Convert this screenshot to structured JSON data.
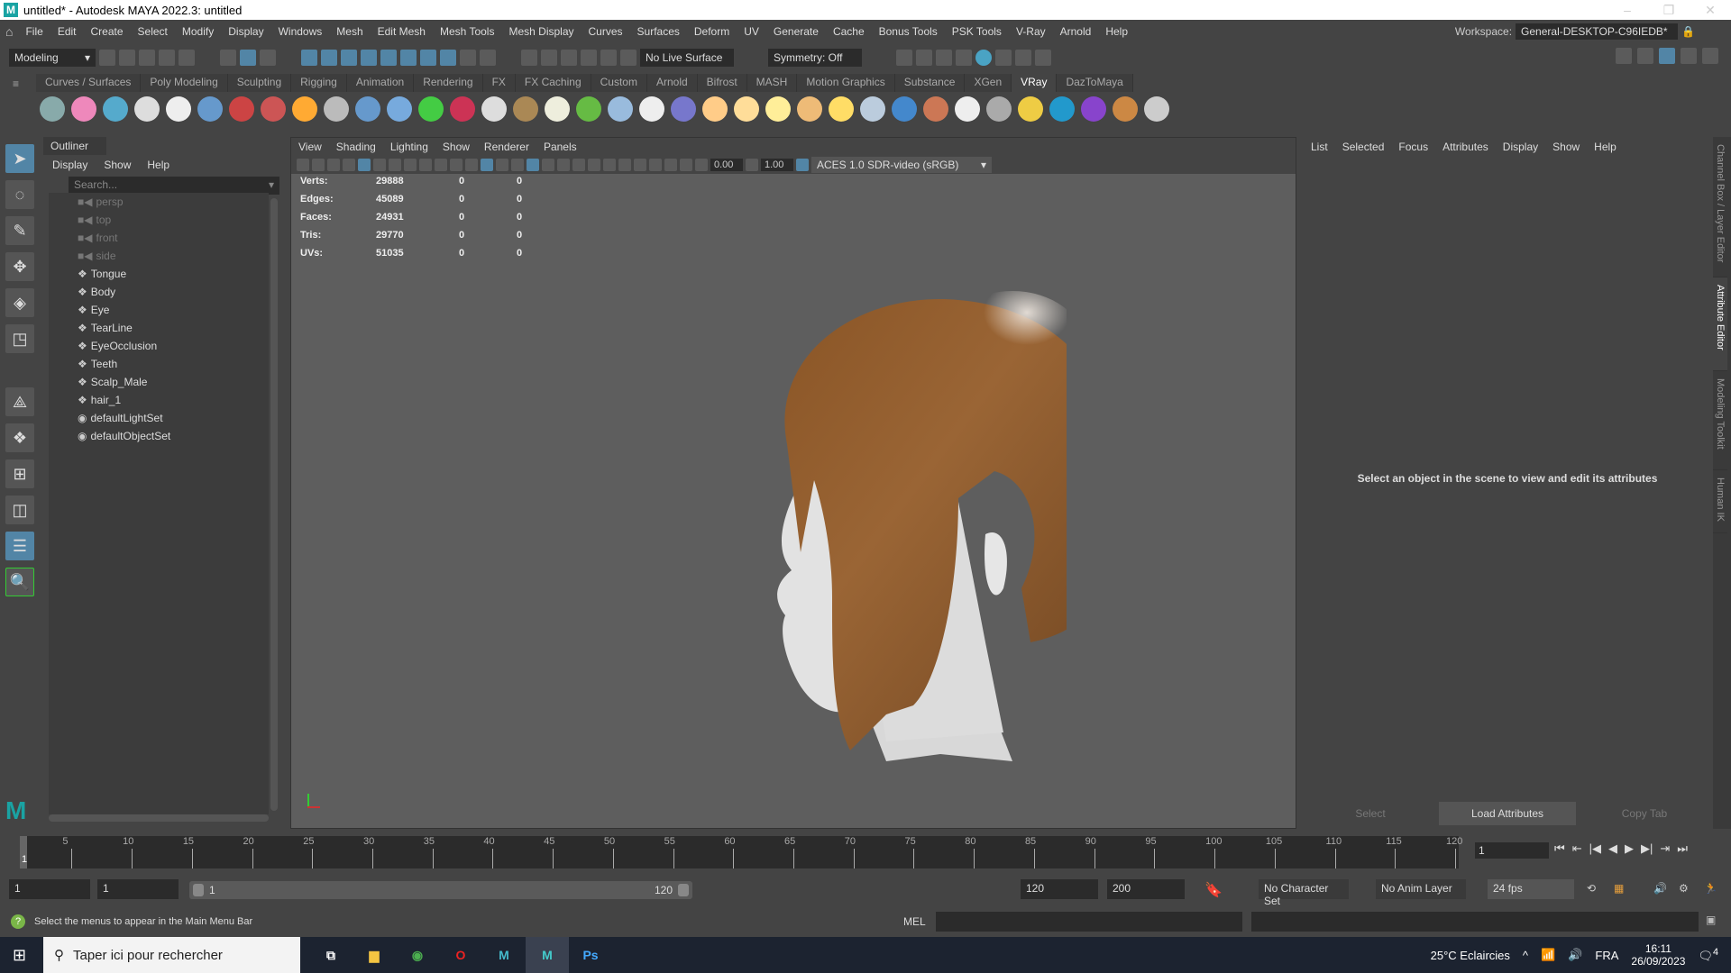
{
  "title": "untitled* - Autodesk MAYA 2022.3: untitled",
  "window_controls": [
    "–",
    "❐",
    "✕"
  ],
  "menu": [
    "File",
    "Edit",
    "Create",
    "Select",
    "Modify",
    "Display",
    "Windows",
    "Mesh",
    "Edit Mesh",
    "Mesh Tools",
    "Mesh Display",
    "Curves",
    "Surfaces",
    "Deform",
    "UV",
    "Generate",
    "Cache",
    "Bonus Tools",
    "PSK Tools",
    "V-Ray",
    "Arnold",
    "Help"
  ],
  "workspace": {
    "label": "Workspace:",
    "value": "General-DESKTOP-C96IEDB*"
  },
  "statusline": {
    "mode": "Modeling",
    "live_surface": "No Live Surface",
    "symmetry": "Symmetry: Off"
  },
  "shelf_tabs": [
    "Curves / Surfaces",
    "Poly Modeling",
    "Sculpting",
    "Rigging",
    "Animation",
    "Rendering",
    "FX",
    "FX Caching",
    "Custom",
    "Arnold",
    "Bifrost",
    "MASH",
    "Motion Graphics",
    "Substance",
    "XGen",
    "VRay",
    "DazToMaya"
  ],
  "shelf_active": "VRay",
  "shelf_icons": [
    "#8aa",
    "#e8b",
    "#5ac",
    "#ddd",
    "#eee",
    "#69c",
    "#c44",
    "#c55",
    "#fa3",
    "#bbb",
    "#69c",
    "#7ad",
    "#4c4",
    "#c35",
    "#ddd",
    "#a85",
    "#eed",
    "#6b4",
    "#9bd",
    "#eee",
    "#77c",
    "#fc8",
    "#fd9",
    "#fe9",
    "#eb7",
    "#fd6",
    "#bcd",
    "#48c",
    "#c75",
    "#eee",
    "#aaa",
    "#ec4",
    "#29c",
    "#84c",
    "#c84",
    "#ccc"
  ],
  "outliner": {
    "title": "Outliner",
    "menu": [
      "Display",
      "Show",
      "Help"
    ],
    "search_placeholder": "Search...",
    "items": [
      {
        "name": "persp",
        "type": "camera"
      },
      {
        "name": "top",
        "type": "camera"
      },
      {
        "name": "front",
        "type": "camera"
      },
      {
        "name": "side",
        "type": "camera"
      },
      {
        "name": "Tongue",
        "type": "mesh"
      },
      {
        "name": "Body",
        "type": "mesh"
      },
      {
        "name": "Eye",
        "type": "mesh"
      },
      {
        "name": "TearLine",
        "type": "mesh"
      },
      {
        "name": "EyeOcclusion",
        "type": "mesh"
      },
      {
        "name": "Teeth",
        "type": "mesh"
      },
      {
        "name": "Scalp_Male",
        "type": "mesh"
      },
      {
        "name": "hair_1",
        "type": "mesh"
      },
      {
        "name": "defaultLightSet",
        "type": "set"
      },
      {
        "name": "defaultObjectSet",
        "type": "set"
      }
    ]
  },
  "viewport": {
    "menu": [
      "View",
      "Shading",
      "Lighting",
      "Show",
      "Renderer",
      "Panels"
    ],
    "exposure": "0.00",
    "gamma": "1.00",
    "color_space": "ACES 1.0 SDR-video (sRGB)",
    "hud": [
      [
        "Verts:",
        "29888",
        "0",
        "0"
      ],
      [
        "Edges:",
        "45089",
        "0",
        "0"
      ],
      [
        "Faces:",
        "24931",
        "0",
        "0"
      ],
      [
        "Tris:",
        "29770",
        "0",
        "0"
      ],
      [
        "UVs:",
        "51035",
        "0",
        "0"
      ]
    ]
  },
  "attribute_editor": {
    "menu": [
      "List",
      "Selected",
      "Focus",
      "Attributes",
      "Display",
      "Show",
      "Help"
    ],
    "message": "Select an object in the scene to view and edit its attributes",
    "buttons": [
      "Select",
      "Load Attributes",
      "Copy Tab"
    ]
  },
  "side_tabs": [
    "Channel Box / Layer Editor",
    "Attribute Editor",
    "Modeling Toolkit",
    "Human IK"
  ],
  "timeline": {
    "ticks": [
      5,
      10,
      15,
      20,
      25,
      30,
      35,
      40,
      45,
      50,
      55,
      60,
      65,
      70,
      75,
      80,
      85,
      90,
      95,
      100,
      105,
      110,
      115,
      120
    ],
    "start_label": "1",
    "current_frame": "1",
    "playback": [
      "⏮",
      "⇤",
      "|◀",
      "◀",
      "▶",
      "▶|",
      "⇥",
      "⏭"
    ]
  },
  "range": {
    "start": "1",
    "anim_start": "1",
    "slider_start": "1",
    "slider_end": "120",
    "anim_end": "120",
    "end": "200",
    "character_set": "No Character Set",
    "anim_layer": "No Anim Layer",
    "fps": "24 fps"
  },
  "command": {
    "lang": "MEL",
    "help": "Select the menus to appear in the Main Menu Bar"
  },
  "taskbar": {
    "search": "Taper ici pour rechercher",
    "weather": "25°C  Eclaircies",
    "lang": "FRA",
    "time": "16:11",
    "date": "26/09/2023",
    "notifications": "4"
  }
}
